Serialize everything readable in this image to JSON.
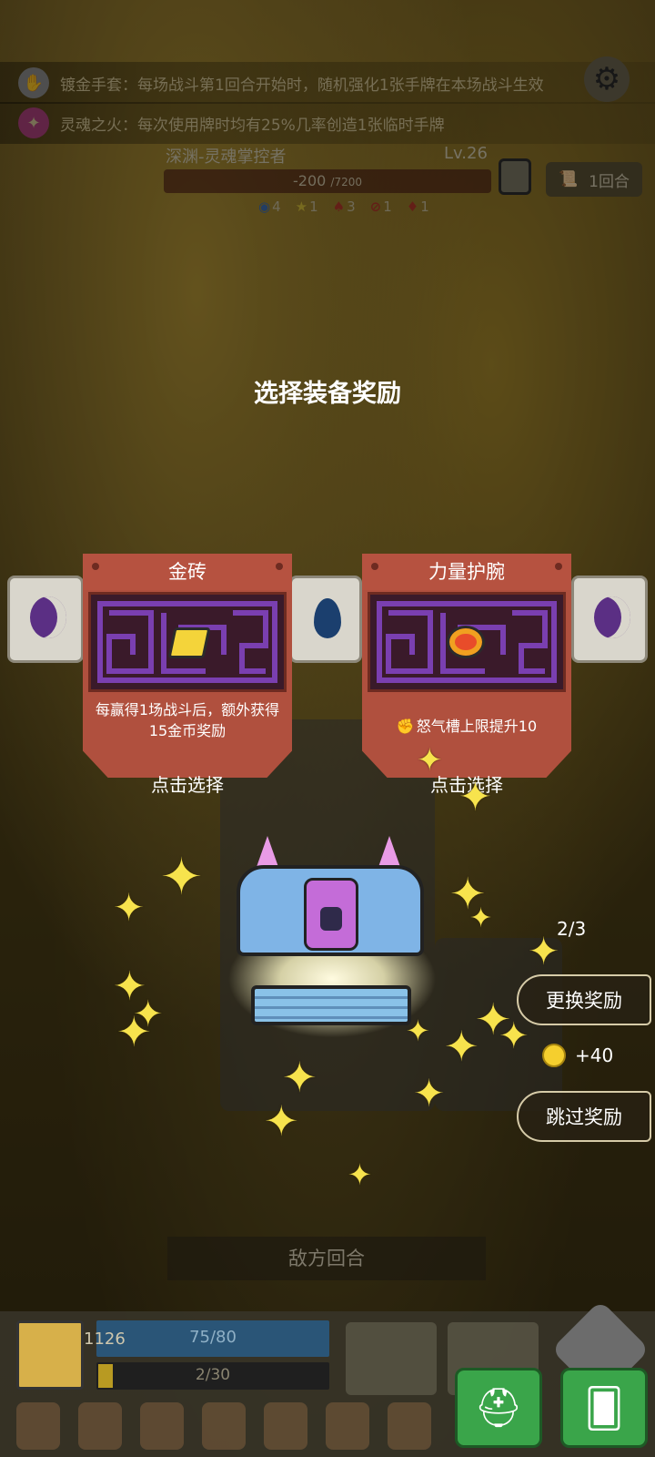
{
  "relics": [
    {
      "text": "镀金手套：每场战斗第1回合开始时，随机强化1张手牌在本场战斗生效",
      "icon": "glove-icon"
    },
    {
      "text": "灵魂之火：每次使用牌时均有25%几率创造1张临时手牌",
      "icon": "soul-fire-icon"
    }
  ],
  "enemy": {
    "name": "深渊-灵魂掌控者",
    "level": "Lv.26",
    "hp_current": "-200",
    "hp_max": "/7200",
    "turn_label": "1回合",
    "statuses": [
      "4",
      "1",
      "3",
      "1",
      "1"
    ]
  },
  "title": "选择装备奖励",
  "rewards": [
    {
      "name": "金砖",
      "desc": "每赢得1场战斗后，额外获得15金币奖励",
      "action": "点击选择"
    },
    {
      "name": "力量护腕",
      "desc": "怒气槽上限提升10",
      "action": "点击选择"
    }
  ],
  "counter": "2/3",
  "change_label": "更换奖励",
  "coin_bonus": "+40",
  "skip_label": "跳过奖励",
  "enemy_turn": "敌方回合",
  "player": {
    "shield": "1126",
    "hp": "75/80",
    "rage": "2/30"
  },
  "colors": {
    "card_red": "#b0503e",
    "accent_gold": "#f7e34d",
    "maze_purple": "#7a3fb0"
  }
}
